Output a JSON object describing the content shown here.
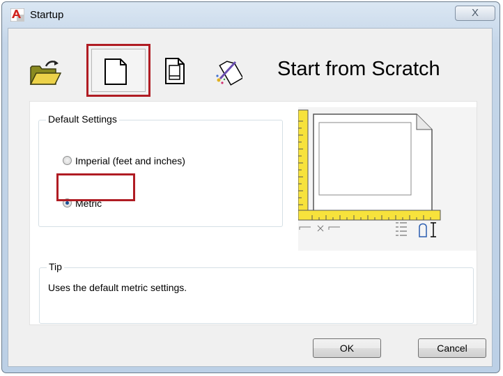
{
  "window": {
    "title": "Startup",
    "close_label": "X"
  },
  "toolbar": {
    "buttons": [
      {
        "name": "open-drawing",
        "icon": "open-folder-icon",
        "selected": false
      },
      {
        "name": "start-from-scratch",
        "icon": "blank-page-icon",
        "selected": true
      },
      {
        "name": "use-template",
        "icon": "template-page-icon",
        "selected": false
      },
      {
        "name": "use-wizard",
        "icon": "wizard-page-icon",
        "selected": false
      }
    ]
  },
  "heading": "Start from Scratch",
  "default_settings": {
    "legend": "Default Settings",
    "options": [
      {
        "label": "Imperial (feet and inches)",
        "checked": false
      },
      {
        "label": "Metric",
        "checked": true
      }
    ]
  },
  "preview": {
    "icon": "drawing-units-preview-icon"
  },
  "tip": {
    "legend": "Tip",
    "text": "Uses the default metric settings."
  },
  "buttons": {
    "ok": "OK",
    "cancel": "Cancel"
  },
  "colors": {
    "highlight": "#b01c23",
    "radio_dot": "#1b4f92",
    "ruler": "#f7e23c"
  }
}
